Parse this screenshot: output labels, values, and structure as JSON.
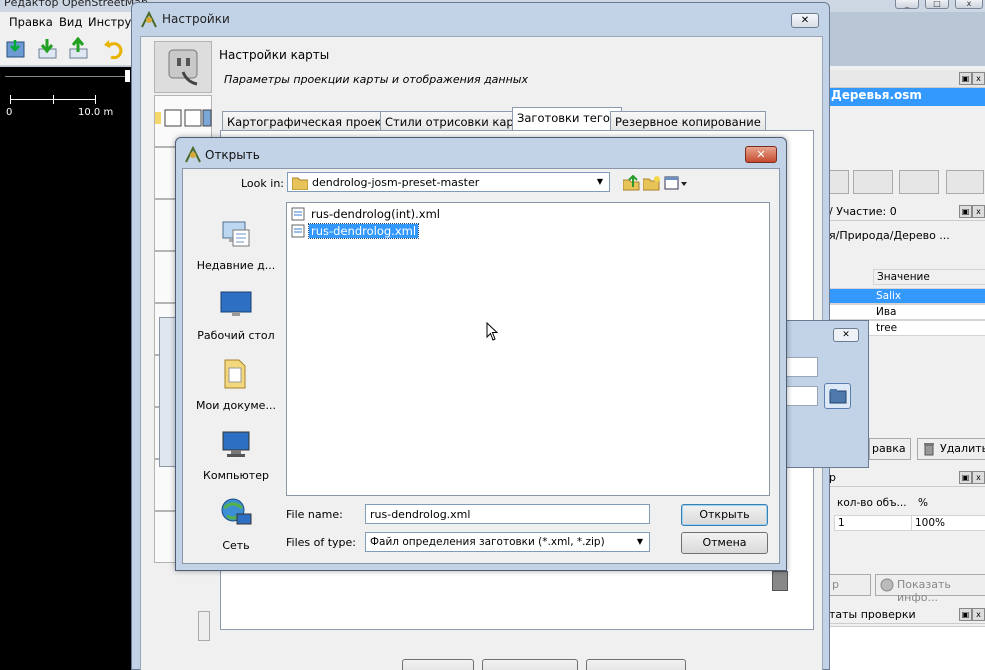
{
  "main_window": {
    "title": "Редактор OpenStreetMap",
    "menu": [
      "Правка",
      "Вид",
      "Инстру"
    ],
    "scale": {
      "start": "0",
      "end": "10.0 m"
    }
  },
  "right_panels": {
    "layers_item": "Деревья.osm",
    "selection_title": "/ Участие: 0",
    "preset_path": "я/Природа/Дерево ...",
    "tags_header_value": "Значение",
    "tag_values": [
      "Salix",
      "Ива",
      "tree"
    ],
    "edit_label": "равка",
    "delete_label": "Удалить",
    "table_head": [
      "р",
      "кол-во объ...",
      "%"
    ],
    "table_row": [
      "1",
      "100%"
    ],
    "pref_label": "р",
    "show_info_label": "Показать инфо...",
    "validation_title": "таты проверки"
  },
  "prefs_dialog": {
    "title": "Настройки",
    "heading": "Настройки карты",
    "description": "Параметры проекции карты и отображения данных",
    "tabs": [
      "Картографическая проекция",
      "Стили отрисовки карты",
      "Заготовки тегов",
      "Резервное копирование"
    ],
    "active_tab": "Заготовки тегов"
  },
  "open_dialog": {
    "title": "Открыть",
    "look_in_label": "Look in:",
    "look_in_value": "dendrolog-josm-preset-master",
    "places": [
      "Недавние д...",
      "Рабочий стол",
      "Мои докуме...",
      "Компьютер",
      "Сеть"
    ],
    "files": [
      {
        "name": "rus-dendrolog(int).xml",
        "selected": false
      },
      {
        "name": "rus-dendrolog.xml",
        "selected": true
      }
    ],
    "file_name_label": "File name:",
    "file_name_value": "rus-dendrolog.xml",
    "files_of_type_label": "Files of type:",
    "files_of_type_value": "Файл определения заготовки (*.xml, *.zip)",
    "open_button": "Открыть",
    "cancel_button": "Отмена"
  },
  "colors": {
    "selection": "#3399ff",
    "dialog_frame": "#c2d3e7",
    "close_red": "#c44a2e"
  }
}
